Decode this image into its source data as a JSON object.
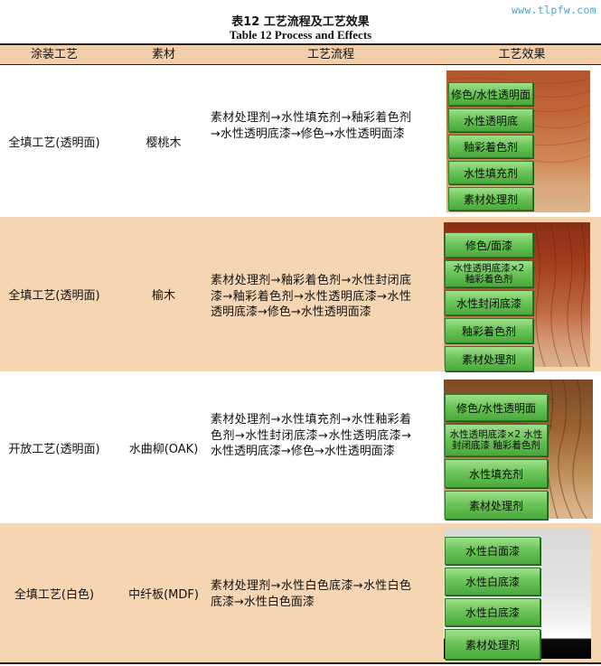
{
  "watermark": "www.tlpfw.com",
  "caption_zh": "表12  工艺流程及工艺效果",
  "caption_en": "Table 12   Process and Effects",
  "headers": [
    "涂装工艺",
    "素材",
    "工艺流程",
    "工艺效果"
  ],
  "rows": [
    {
      "process": "全填工艺(透明面)",
      "material": "樱桃木",
      "flow": "素材处理剂→水性填充剂→釉彩着色剂→水性透明底漆→修色→水性透明面漆",
      "layers": [
        "修色/水性透明面",
        "水性透明底",
        "釉彩着色剂",
        "水性填充剂",
        "素材处理剂"
      ]
    },
    {
      "process": "全填工艺(透明面)",
      "material": "榆木",
      "flow": "素材处理剂→釉彩着色剂→水性封闭底漆→釉彩着色剂→水性透明底漆→水性透明底漆→修色→水性透明面漆",
      "layers": [
        "修色/面漆",
        "水性透明底漆×2 釉彩着色剂",
        "水性封闭底漆",
        "釉彩着色剂",
        "素材处理剂"
      ]
    },
    {
      "process": "开放工艺(透明面)",
      "material": "水曲柳(OAK)",
      "flow": "素材处理剂→水性填充剂→水性釉彩着色剂→水性封闭底漆→水性透明底漆→水性透明底漆→修色→水性透明面漆",
      "layers": [
        "修色/水性透明面",
        "水性透明底漆×2 水性封闭底漆 釉彩着色剂",
        "水性填充剂",
        "素材处理剂"
      ]
    },
    {
      "process": "全填工艺(白色)",
      "material": "中纤板(MDF)",
      "flow": "素材处理剂→水性白色底漆→水性白色底漆→水性白色面漆",
      "layers": [
        "水性白面漆",
        "水性白底漆",
        "水性白底漆",
        "素材处理剂"
      ]
    }
  ],
  "colors": {
    "header_bg": "#f2cfaa",
    "alt_row_bg": "#f5d5b2",
    "layer_button_green": "#6cc558",
    "watermark": "#4aa6d6"
  }
}
